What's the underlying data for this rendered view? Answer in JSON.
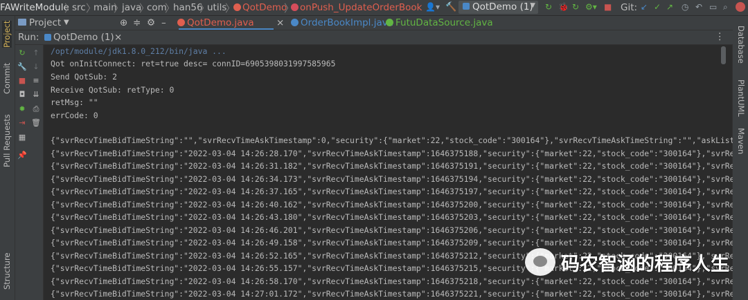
{
  "breadcrumb": {
    "items": [
      "FAWriteModule",
      "src",
      "main",
      "java",
      "com",
      "han56",
      "utils",
      "QotDemo",
      "onPush_UpdateOrderBook"
    ],
    "separator": "〉"
  },
  "toolbar": {
    "run_config": "QotDemo (1)",
    "git_label": "Git:"
  },
  "editor_tabs": {
    "project_label": "Project",
    "tabs": [
      {
        "label": "QotDemo.java",
        "color": "#e05f4f"
      },
      {
        "label": "OrderBookImpl.java",
        "color": "#4a88c7"
      },
      {
        "label": "FutuDataSource.java",
        "color": "#62b543"
      }
    ]
  },
  "left_strip": {
    "project": "Project",
    "commit": "Commit",
    "pull_requests": "Pull Requests",
    "structure": "Structure"
  },
  "right_strip": {
    "database": "Database",
    "plantuml": "PlantUML",
    "maven": "Maven"
  },
  "run_panel": {
    "run_label": "Run:",
    "tab_label": "QotDemo (1)"
  },
  "console": {
    "java_path": "/opt/module/jdk1.8.0_212/bin/java ...",
    "lines": [
      "Qot onInitConnect: ret=true desc= connID=6905398031997585965",
      "Send QotSub: 2",
      "Receive QotSub: retType: 0",
      "retMsg: \"\"",
      "errCode: 0"
    ],
    "json_first": "{\"svrRecvTimeBidTimeString\":\"\",\"svrRecvTimeAskTimestamp\":0,\"security\":{\"market\":22,\"stock_code\":\"300164\"},\"svrRecvTimeAskTimeString\":\"\",\"askList\"",
    "json_lines": [
      "{\"svrRecvTimeBidTimeString\":\"2022-03-04 14:26:28.170\",\"svrRecvTimeAskTimestamp\":1646375188,\"security\":{\"market\":22,\"stock_code\":\"300164\"},\"svrRec",
      "{\"svrRecvTimeBidTimeString\":\"2022-03-04 14:26:31.182\",\"svrRecvTimeAskTimestamp\":1646375191,\"security\":{\"market\":22,\"stock_code\":\"300164\"},\"svrRec",
      "{\"svrRecvTimeBidTimeString\":\"2022-03-04 14:26:34.173\",\"svrRecvTimeAskTimestamp\":1646375194,\"security\":{\"market\":22,\"stock_code\":\"300164\"},\"svrRec",
      "{\"svrRecvTimeBidTimeString\":\"2022-03-04 14:26:37.165\",\"svrRecvTimeAskTimestamp\":1646375197,\"security\":{\"market\":22,\"stock_code\":\"300164\"},\"svrRec",
      "{\"svrRecvTimeBidTimeString\":\"2022-03-04 14:26:40.162\",\"svrRecvTimeAskTimestamp\":1646375200,\"security\":{\"market\":22,\"stock_code\":\"300164\"},\"svrRec",
      "{\"svrRecvTimeBidTimeString\":\"2022-03-04 14:26:43.180\",\"svrRecvTimeAskTimestamp\":1646375203,\"security\":{\"market\":22,\"stock_code\":\"300164\"},\"svrRec",
      "{\"svrRecvTimeBidTimeString\":\"2022-03-04 14:26:46.201\",\"svrRecvTimeAskTimestamp\":1646375206,\"security\":{\"market\":22,\"stock_code\":\"300164\"},\"svrRec",
      "{\"svrRecvTimeBidTimeString\":\"2022-03-04 14:26:49.158\",\"svrRecvTimeAskTimestamp\":1646375209,\"security\":{\"market\":22,\"stock_code\":\"300164\"},\"svrRec",
      "{\"svrRecvTimeBidTimeString\":\"2022-03-04 14:26:52.165\",\"svrRecvTimeAskTimestamp\":1646375212,\"security\":{\"market\":22,\"stock_code\":\"300164\"},\"svrRec",
      "{\"svrRecvTimeBidTimeString\":\"2022-03-04 14:26:55.157\",\"svrRecvTimeAskTimestamp\":1646375215,\"security\":{\"market\":22,\"stock_code\":\"300164\"},\"svrRec",
      "{\"svrRecvTimeBidTimeString\":\"2022-03-04 14:26:58.170\",\"svrRecvTimeAskTimestamp\":1646375218,\"security\":{\"market\":22,\"stock_code\":\"300164\"},\"svrRec",
      "{\"svrRecvTimeBidTimeString\":\"2022-03-04 14:27:01.172\",\"svrRecvTimeAskTimestamp\":1646375221,\"security\":{\"market\":22,\"stock_code\":\"300164\"},\"svrRec"
    ]
  },
  "watermark": {
    "text": "码农智涵的程序人生"
  }
}
